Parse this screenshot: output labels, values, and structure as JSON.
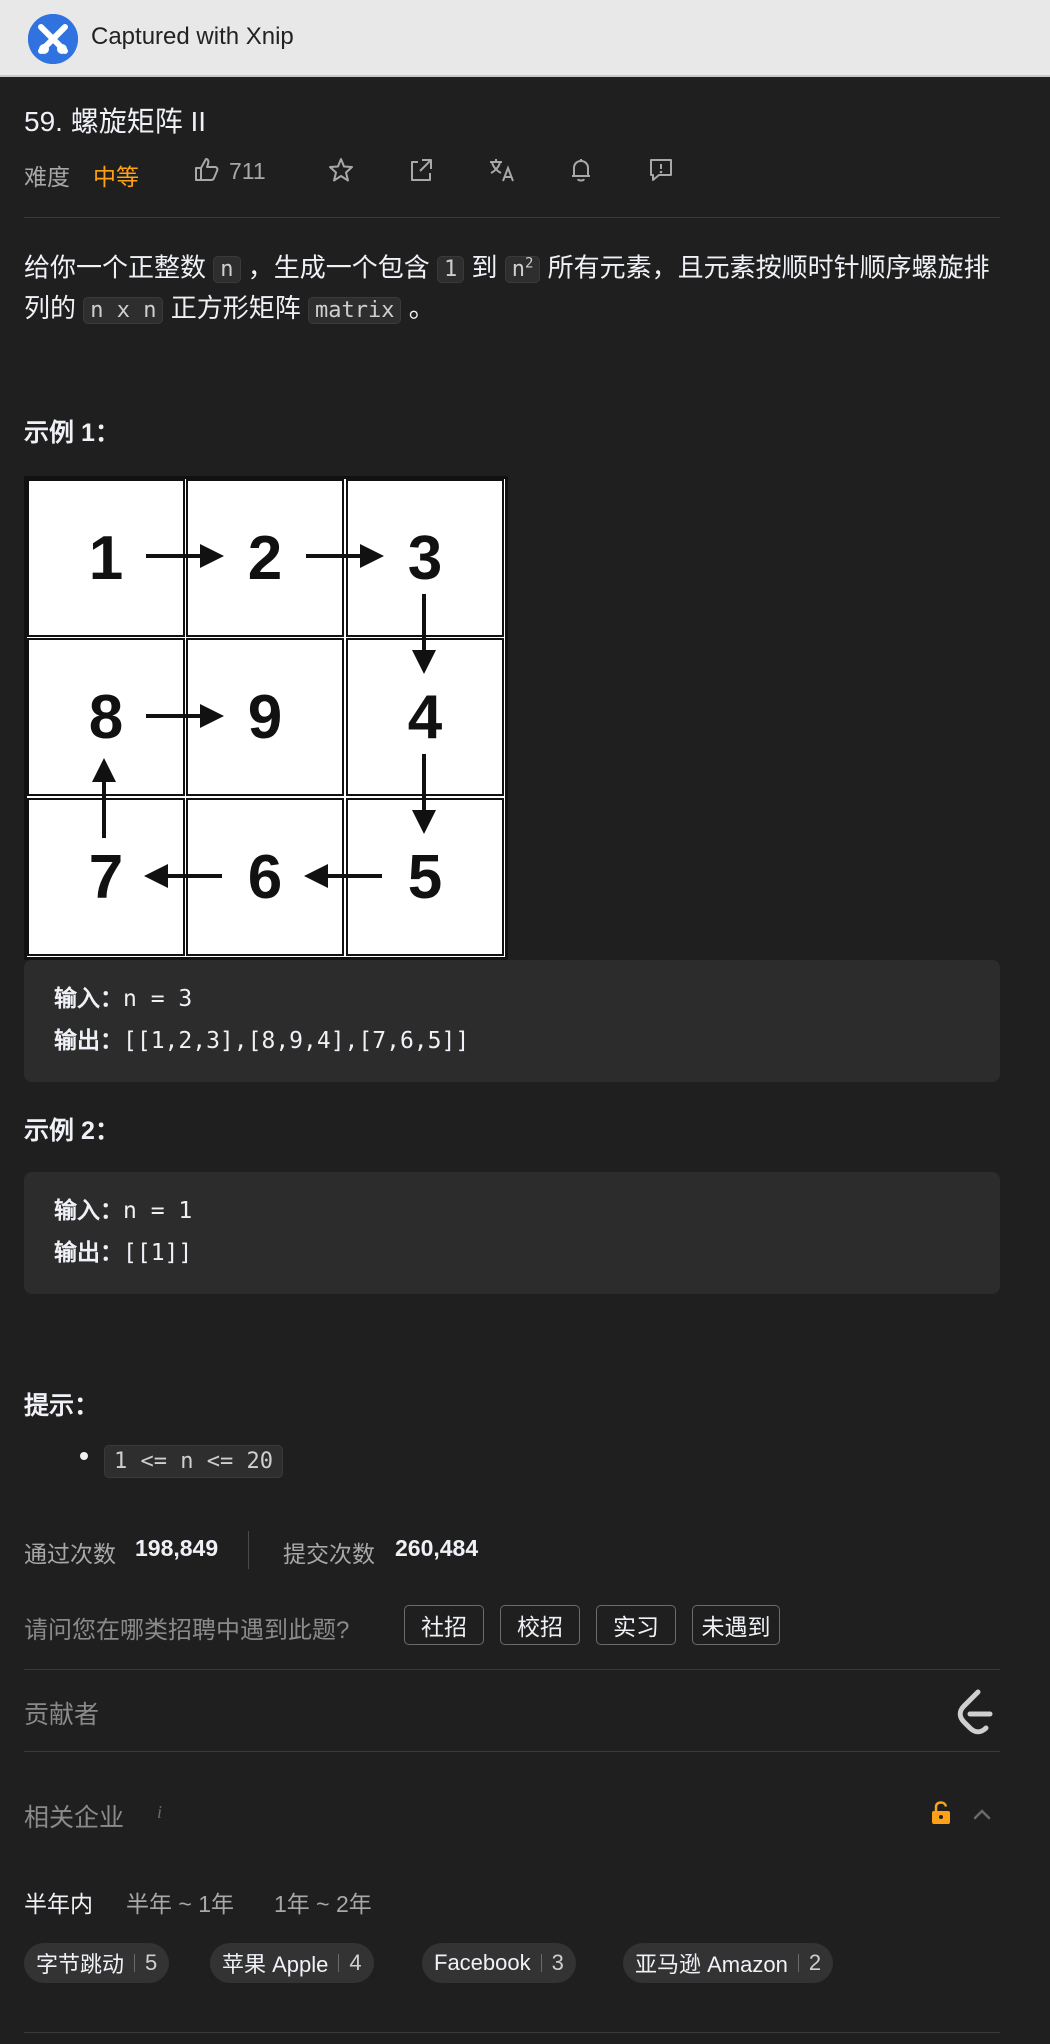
{
  "app": {
    "capture_label": "Captured with Xnip"
  },
  "problem": {
    "title": "59. 螺旋矩阵 II",
    "difficulty_label": "难度",
    "difficulty": "中等",
    "likes": "711",
    "desc_p1": "给你一个正整数",
    "code_n": "n",
    "desc_p2": "，生成一个包含",
    "code_1": "1",
    "desc_p3": "到",
    "code_n2_base": "n",
    "code_n2_exp": "2",
    "desc_p4": "所有元素，且元素按顺时针顺序螺旋排列的",
    "code_nxn": "n x n",
    "desc_p5": "正方形矩阵",
    "code_matrix": "matrix",
    "desc_p6": "。"
  },
  "example1": {
    "heading": "示例 1：",
    "matrix": [
      [
        "1",
        "2",
        "3"
      ],
      [
        "8",
        "9",
        "4"
      ],
      [
        "7",
        "6",
        "5"
      ]
    ],
    "input_label": "输入：",
    "input": "n = 3",
    "output_label": "输出：",
    "output": "[[1,2,3],[8,9,4],[7,6,5]]"
  },
  "example2": {
    "heading": "示例 2：",
    "input_label": "输入：",
    "input": "n = 1",
    "output_label": "输出：",
    "output": "[[1]]"
  },
  "hints": {
    "heading": "提示：",
    "item": "1 <= n <= 20"
  },
  "stats": {
    "accepted_label": "通过次数",
    "accepted": "198,849",
    "submitted_label": "提交次数",
    "submitted": "260,484"
  },
  "survey": {
    "question": "请问您在哪类招聘中遇到此题?",
    "options": [
      "社招",
      "校招",
      "实习",
      "未遇到"
    ]
  },
  "contributors": {
    "label": "贡献者"
  },
  "companies": {
    "label": "相关企业",
    "info": "i",
    "tabs": [
      "半年内",
      "半年 ~ 1年",
      "1年 ~ 2年"
    ],
    "chips": [
      {
        "name": "字节跳动",
        "count": "5"
      },
      {
        "name": "苹果 Apple",
        "count": "4"
      },
      {
        "name": "Facebook",
        "count": "3"
      },
      {
        "name": "亚马逊 Amazon",
        "count": "2"
      }
    ]
  },
  "icons": {
    "like": "thumbs-up-icon",
    "star": "star-icon",
    "share": "share-icon",
    "translate": "translate-icon",
    "bell": "bell-icon",
    "feedback": "feedback-icon",
    "lock": "unlock-icon",
    "chevron": "chevron-up-icon",
    "leetcode": "leetcode-logo-icon"
  },
  "colors": {
    "accent": "#ffa116",
    "background": "#1f1f1f",
    "code_block": "#2c2c2c"
  }
}
